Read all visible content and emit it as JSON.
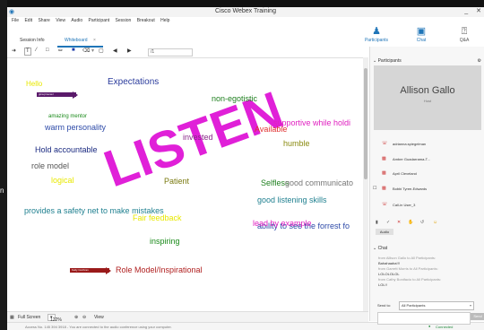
{
  "window": {
    "title": "Cisco Webex Training",
    "min": "_",
    "close": "✕"
  },
  "menu": [
    "File",
    "Edit",
    "Share",
    "View",
    "Audio",
    "Participant",
    "Session",
    "Breakout",
    "Help"
  ],
  "tabs": [
    {
      "label": "Session Info"
    },
    {
      "label": "Whiteboard",
      "close": "×"
    }
  ],
  "right_tools": [
    {
      "label": "Participants",
      "icon": "person-icon"
    },
    {
      "label": "Chat",
      "icon": "chat-bubble-icon"
    },
    {
      "label": "Q&A",
      "icon": "question-icon"
    }
  ],
  "toolbar": {
    "page_value": "/1"
  },
  "canvas": {
    "scribble": "LISTEN",
    "notes": [
      {
        "text": "Hello",
        "color": "#e8e800"
      },
      {
        "text": "Expectations",
        "color": "#2a3b9c"
      },
      {
        "text": "non-egotistic",
        "color": "#208020"
      },
      {
        "text": "amazing mentor",
        "color": "#1a8a1a"
      },
      {
        "text": "warm personality",
        "color": "#2d4aa8"
      },
      {
        "text": "invested",
        "color": "#8a2a8a"
      },
      {
        "text": "Available",
        "color": "#e03030"
      },
      {
        "text": "supportive while holdi",
        "color": "#e020c0"
      },
      {
        "text": "humble",
        "color": "#8a8a10"
      },
      {
        "text": "Hold accountable",
        "color": "#1a2a80"
      },
      {
        "text": "role model",
        "color": "#555555"
      },
      {
        "text": "logical",
        "color": "#e8e800"
      },
      {
        "text": "Patient",
        "color": "#7a7a10"
      },
      {
        "text": "Selfless",
        "color": "#208020"
      },
      {
        "text": "good communicato",
        "color": "#777777"
      },
      {
        "text": "good listening skills",
        "color": "#208090"
      },
      {
        "text": "provides a safety net to make mistakes",
        "color": "#208090"
      },
      {
        "text": "Fair feedback",
        "color": "#e8e800"
      },
      {
        "text": "ability to see the forrest fo",
        "color": "#2d4aa8"
      },
      {
        "text": "lead by example",
        "color": "#e020c0"
      },
      {
        "text": "inspiring",
        "color": "#1a8a1a"
      },
      {
        "text": "Role Model/Inspirational",
        "color": "#b02020"
      }
    ],
    "tags": [
      {
        "text": "gina.jimenez",
        "color": "#5a1a6a"
      },
      {
        "text": "Kelly Cochran",
        "color": "#9a1a1a"
      }
    ]
  },
  "bottombar": {
    "full_screen": "Full Screen",
    "zoom": "122%",
    "view": "View"
  },
  "status": {
    "text": "Access No. 145 394 3918 - You are connected to the audio conference using your computer.",
    "connected": "Connected"
  },
  "panel": {
    "participants_header": "Participants",
    "host_name": "Allison Gallo",
    "host_role": "Host",
    "participants": [
      "adrianna.spiegelman",
      "Amber Guadarrama-T...",
      "April Cleveland",
      "Bobbi Tyree-Edwards",
      "Call-in User_3"
    ],
    "audio_label": "Audio",
    "chat_header": "Chat",
    "chat_messages": [
      {
        "text": "from Allison Gallo to All Participants:",
        "meta": true
      },
      {
        "text": "Bahahaaha!!!",
        "meta": false
      },
      {
        "text": "from Garrett Morris to All Participants:",
        "meta": true
      },
      {
        "text": "LOLOLOLOL",
        "meta": false
      },
      {
        "text": "from Cathy Bonifacio to All Participants:",
        "meta": true
      },
      {
        "text": "LOL!!",
        "meta": false
      }
    ],
    "send_to_label": "Send to:",
    "send_to_value": "All Participants",
    "send_label": "Send"
  }
}
